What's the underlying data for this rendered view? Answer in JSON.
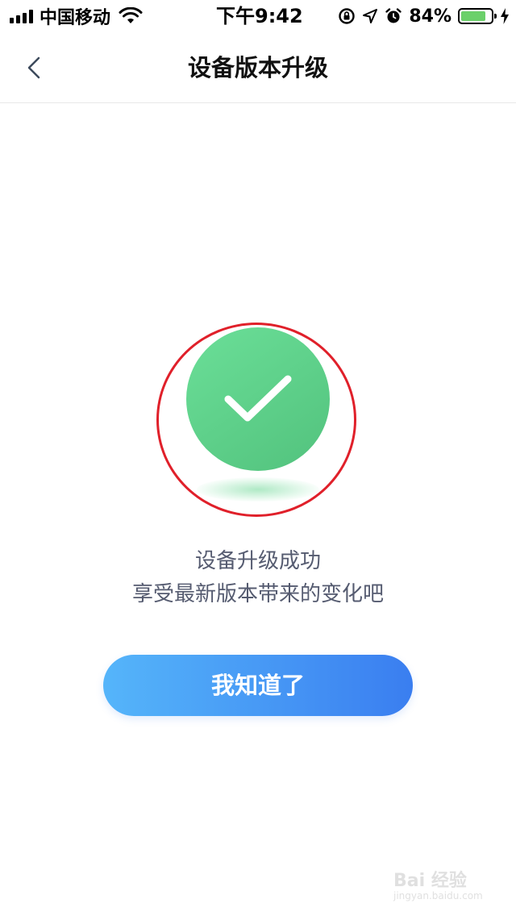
{
  "status_bar": {
    "carrier": "中国移动",
    "time": "下午9:42",
    "battery_percent": "84%",
    "battery_level": 0.84,
    "icons": [
      "signal-icon",
      "wifi-icon",
      "orientation-lock-icon",
      "location-icon",
      "alarm-icon",
      "battery-icon",
      "charging-icon"
    ]
  },
  "nav": {
    "title": "设备版本升级",
    "back_icon": "chevron-left-icon"
  },
  "success": {
    "icon": "checkmark-icon",
    "line1": "设备升级成功",
    "line2": "享受最新版本带来的变化吧"
  },
  "actions": {
    "confirm_label": "我知道了"
  },
  "watermark": {
    "text": "Bai 经验",
    "sub": "jingyan.baidu.com"
  },
  "colors": {
    "success_green": "#5ccd88",
    "button_start": "#55b5fa",
    "button_end": "#3a7ef0",
    "highlight_red": "#e0202a"
  }
}
